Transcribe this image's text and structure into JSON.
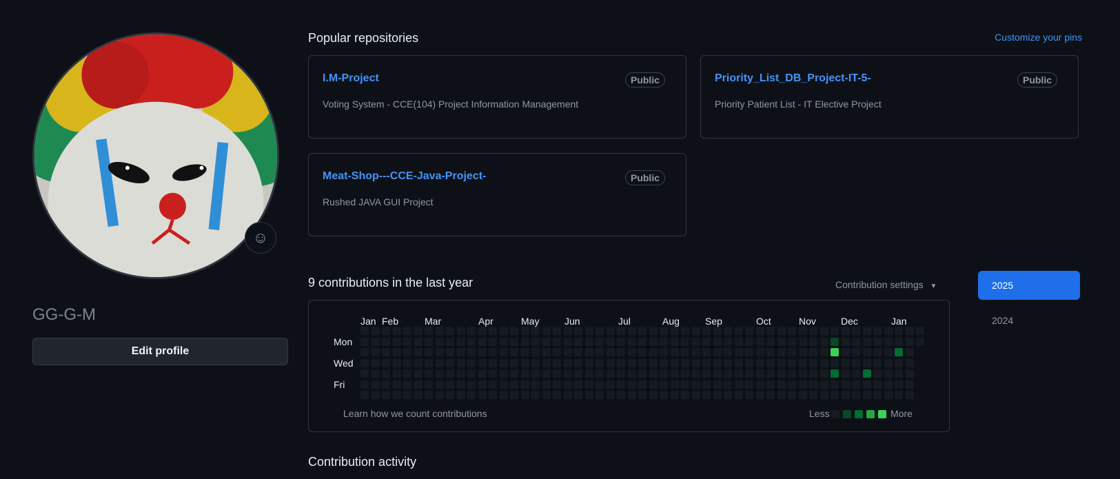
{
  "profile": {
    "username": "GG-G-M",
    "edit_label": "Edit profile",
    "emoji_icon": "smiley-icon"
  },
  "popular": {
    "title": "Popular repositories",
    "customize_label": "Customize your pins",
    "repos": [
      {
        "name": "I.M-Project",
        "badge": "Public",
        "description": "Voting System - CCE(104) Project Information Management"
      },
      {
        "name": "Priority_List_DB_Project-IT-5-",
        "badge": "Public",
        "description": "Priority Patient List - IT Elective Project"
      },
      {
        "name": "Meat-Shop---CCE-Java-Project-",
        "badge": "Public",
        "description": "Rushed JAVA GUI Project"
      }
    ]
  },
  "contributions": {
    "title": "9 contributions in the last year",
    "settings_label": "Contribution settings",
    "months": [
      "Jan",
      "Feb",
      "Mar",
      "Apr",
      "May",
      "Jun",
      "Jul",
      "Aug",
      "Sep",
      "Oct",
      "Nov",
      "Dec",
      "Jan"
    ],
    "days": [
      "Mon",
      "Wed",
      "Fri"
    ],
    "learn_label": "Learn how we count contributions",
    "legend_less": "Less",
    "legend_more": "More",
    "colors": {
      "level0": "#161b22",
      "level1": "#0e4429",
      "level2": "#006d32",
      "level3": "#26a641",
      "level4": "#39d353"
    },
    "active_cells": [
      {
        "week": 44,
        "day": 1,
        "level": 1
      },
      {
        "week": 44,
        "day": 2,
        "level": 4
      },
      {
        "week": 44,
        "day": 4,
        "level": 2
      },
      {
        "week": 47,
        "day": 4,
        "level": 2
      },
      {
        "week": 50,
        "day": 2,
        "level": 2
      }
    ]
  },
  "years": {
    "active": "2025",
    "other": "2024"
  },
  "activity": {
    "title": "Contribution activity"
  }
}
